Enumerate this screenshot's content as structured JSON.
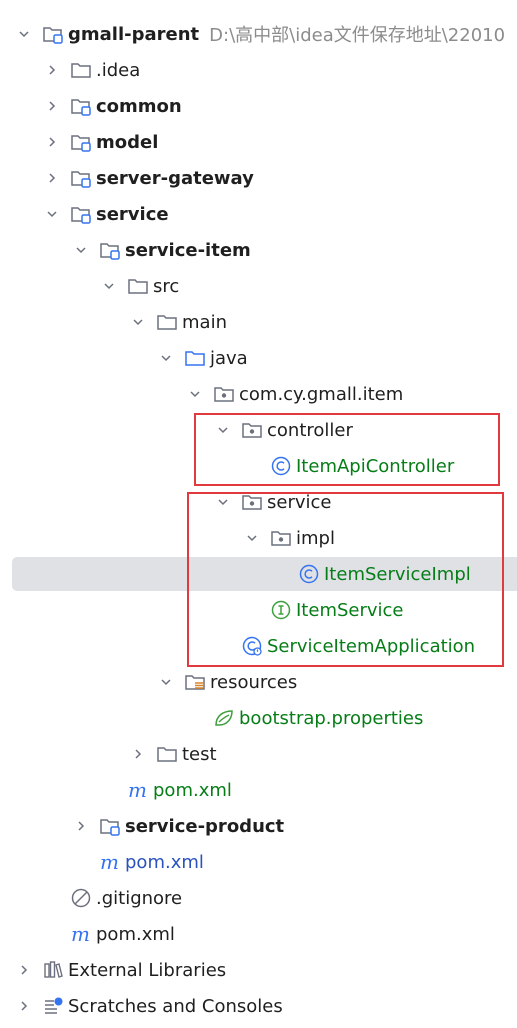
{
  "tree": {
    "root_label": "gmall-parent",
    "root_path": "D:\\高中部\\idea文件保存地址\\22010",
    "idea_label": ".idea",
    "common_label": "common",
    "model_label": "model",
    "server_gateway_label": "server-gateway",
    "service_label": "service",
    "service_item_label": "service-item",
    "src_label": "src",
    "main_label": "main",
    "java_label": "java",
    "package_label": "com.cy.gmall.item",
    "controller_label": "controller",
    "item_api_controller_label": "ItemApiController",
    "service_pkg_label": "service",
    "impl_label": "impl",
    "item_service_impl_label": "ItemServiceImpl",
    "item_service_label": "ItemService",
    "app_label": "ServiceItemApplication",
    "resources_label": "resources",
    "bootstrap_label": "bootstrap.properties",
    "test_label": "test",
    "pom_service_item_label": "pom.xml",
    "service_product_label": "service-product",
    "pom_service_label": "pom.xml",
    "gitignore_label": ".gitignore",
    "pom_root_label": "pom.xml",
    "external_libraries_label": "External Libraries",
    "scratches_label": "Scratches and Consoles"
  },
  "colors": {
    "highlight_box": "#e0393e",
    "selection": "#dfe1e5",
    "class_icon": "#3574f0",
    "interface_icon": "#3f9f3f",
    "vcs_added_text": "#067d17"
  }
}
